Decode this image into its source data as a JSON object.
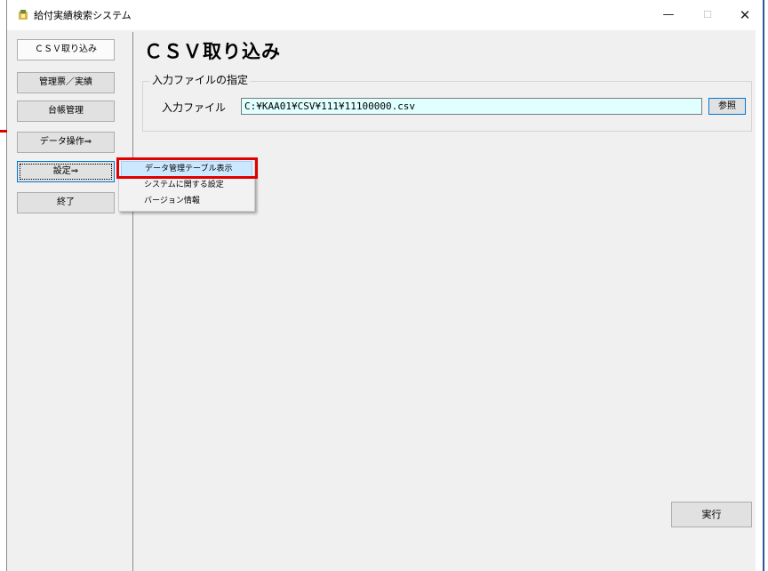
{
  "window": {
    "title": "給付実績検索システム",
    "min_glyph": "—",
    "max_glyph": "☐",
    "close_glyph": "✕"
  },
  "nav": {
    "items": [
      {
        "label": "ＣＳＶ取り込み",
        "state": "active"
      },
      {
        "label": "管理票／実績"
      },
      {
        "label": "台帳管理"
      },
      {
        "label": "データ操作⇒"
      },
      {
        "label": "設定⇒",
        "state": "focused"
      },
      {
        "label": "終了"
      }
    ]
  },
  "main": {
    "title": "ＣＳＶ取り込み",
    "group_label": "入力ファイルの指定",
    "field_label": "入力ファイル",
    "file_path": "C:¥KAA01¥CSV¥111¥11100000.csv",
    "browse_label": "参照",
    "execute_label": "実行"
  },
  "context_menu": {
    "items": [
      {
        "label": "データ管理テーブル表示",
        "highlighted": true
      },
      {
        "label": "システムに関する設定"
      },
      {
        "label": "バージョン情報"
      }
    ]
  },
  "colors": {
    "highlight_box": "#e00000",
    "input_background": "#e0ffff",
    "menu_hover": "#cce8ff",
    "focus_border": "#0078d7"
  }
}
